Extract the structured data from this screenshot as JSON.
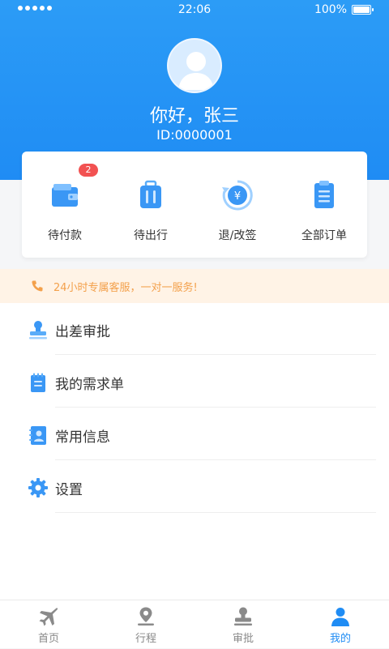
{
  "status_bar": {
    "time": "22:06",
    "battery": "100%"
  },
  "profile": {
    "greeting": "你好，张三",
    "id": "ID:0000001"
  },
  "orders": [
    {
      "label": "待付款",
      "icon": "wallet-icon",
      "badge": "2"
    },
    {
      "label": "待出行",
      "icon": "luggage-icon"
    },
    {
      "label": "退/改签",
      "icon": "refund-icon"
    },
    {
      "label": "全部订单",
      "icon": "clipboard-icon"
    }
  ],
  "notice": {
    "text": "24小时专属客服，一对一服务!",
    "icon": "phone-icon"
  },
  "menu": [
    {
      "label": "出差审批",
      "icon": "approval-stamp-icon"
    },
    {
      "label": "我的需求单",
      "icon": "notepad-icon"
    },
    {
      "label": "常用信息",
      "icon": "contact-card-icon"
    },
    {
      "label": "设置",
      "icon": "gear-icon"
    }
  ],
  "tabs": [
    {
      "label": "首页",
      "icon": "airplane-icon"
    },
    {
      "label": "行程",
      "icon": "location-pin-icon"
    },
    {
      "label": "审批",
      "icon": "stamp-icon"
    },
    {
      "label": "我的",
      "icon": "user-icon",
      "active": true
    }
  ],
  "colors": {
    "primary": "#1f8cf4",
    "badge": "#f25252",
    "notice_bg": "#fff3e6",
    "notice_text": "#f3a04b"
  }
}
